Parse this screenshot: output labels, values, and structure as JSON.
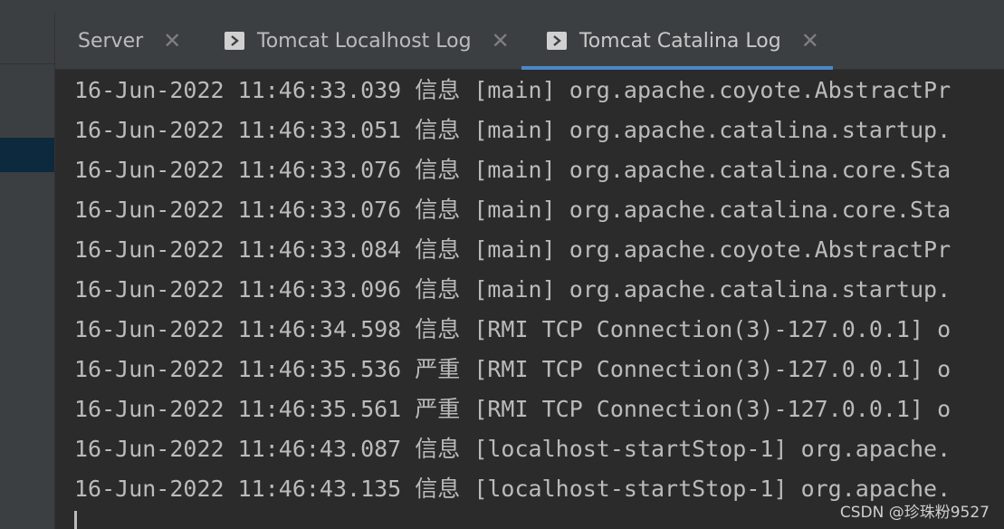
{
  "tabs": [
    {
      "label": "Server",
      "icon": "none",
      "active": false
    },
    {
      "label": "Tomcat Localhost Log",
      "icon": "console-log-icon",
      "active": false
    },
    {
      "label": "Tomcat Catalina Log",
      "icon": "console-log-icon",
      "active": true
    }
  ],
  "close_glyph": "✕",
  "accent_color": "#4a88c7",
  "log_lines": [
    "16-Jun-2022 11:46:33.039 信息 [main] org.apache.coyote.AbstractPr",
    "16-Jun-2022 11:46:33.051 信息 [main] org.apache.catalina.startup.",
    "16-Jun-2022 11:46:33.076 信息 [main] org.apache.catalina.core.Sta",
    "16-Jun-2022 11:46:33.076 信息 [main] org.apache.catalina.core.Sta",
    "16-Jun-2022 11:46:33.084 信息 [main] org.apache.coyote.AbstractPr",
    "16-Jun-2022 11:46:33.096 信息 [main] org.apache.catalina.startup.",
    "16-Jun-2022 11:46:34.598 信息 [RMI TCP Connection(3)-127.0.0.1] o",
    "16-Jun-2022 11:46:35.536 严重 [RMI TCP Connection(3)-127.0.0.1] o",
    "16-Jun-2022 11:46:35.561 严重 [RMI TCP Connection(3)-127.0.0.1] o",
    "16-Jun-2022 11:46:43.087 信息 [localhost-startStop-1] org.apache.",
    "16-Jun-2022 11:46:43.135 信息 [localhost-startStop-1] org.apache."
  ],
  "watermark": "CSDN @珍珠粉9527"
}
